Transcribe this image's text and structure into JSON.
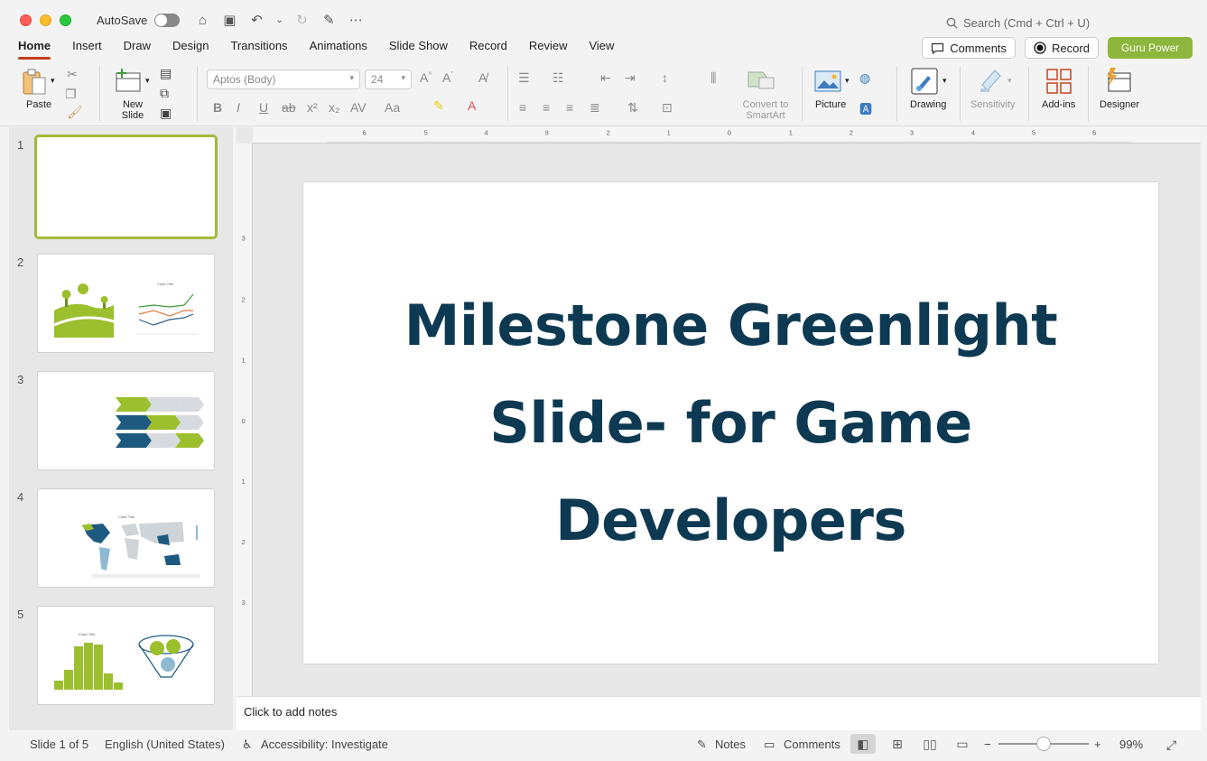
{
  "titlebar": {
    "autosave_label": "AutoSave",
    "search_placeholder": "Search (Cmd + Ctrl + U)"
  },
  "tabs": [
    "Home",
    "Insert",
    "Draw",
    "Design",
    "Transitions",
    "Animations",
    "Slide Show",
    "Record",
    "Review",
    "View"
  ],
  "header_buttons": {
    "comments": "Comments",
    "record": "Record",
    "guru": "Guru Power"
  },
  "ribbon": {
    "paste": "Paste",
    "new_slide": "New Slide",
    "font_name": "Aptos (Body)",
    "font_size": "24",
    "convert_smartart": "Convert to SmartArt",
    "picture": "Picture",
    "drawing": "Drawing",
    "sensitivity": "Sensitivity",
    "addins": "Add-ins",
    "designer": "Designer"
  },
  "thumbnails": [
    "1",
    "2",
    "3",
    "4",
    "5"
  ],
  "thumb_texts": {
    "chart_title": "Chart Title"
  },
  "slide": {
    "title": "Milestone Greenlight Slide- for Game Developers"
  },
  "notes_placeholder": "Click to add notes",
  "status": {
    "slide_count": "Slide 1 of 5",
    "language": "English (United States)",
    "accessibility": "Accessibility: Investigate",
    "notes": "Notes",
    "comments": "Comments",
    "zoom": "99%"
  },
  "colors": {
    "accent_green": "#8cb63c",
    "title_navy": "#0d3a52",
    "tab_underline": "#c43e1c"
  }
}
